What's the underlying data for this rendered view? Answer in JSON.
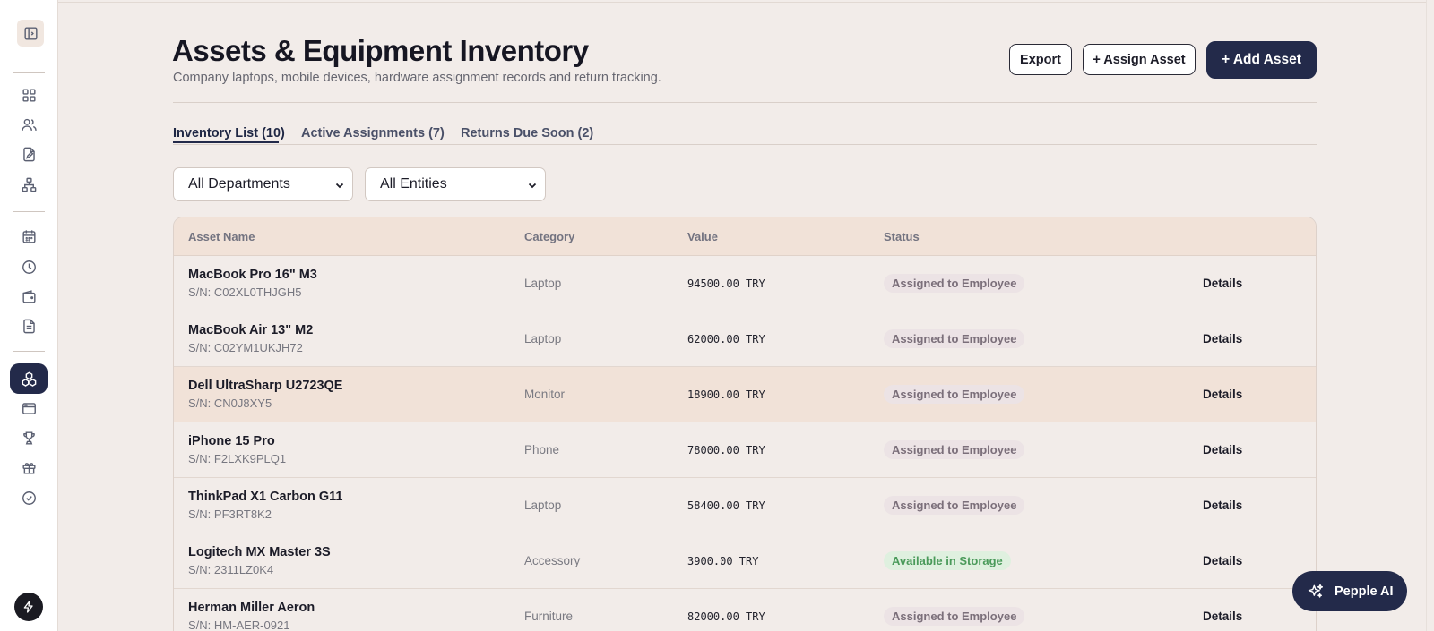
{
  "header": {
    "title": "Assets & Equipment Inventory",
    "subtitle": "Company laptops, mobile devices, hardware assignment records and return tracking.",
    "export_label": "Export",
    "assign_label": "+ Assign Asset",
    "add_label": "+ Add Asset"
  },
  "tabs": [
    {
      "label": "Inventory List (10)",
      "active": true
    },
    {
      "label": "Active Assignments (7)",
      "active": false
    },
    {
      "label": "Returns Due Soon (2)",
      "active": false
    }
  ],
  "filters": {
    "department": "All Departments",
    "entity": "All Entities"
  },
  "table": {
    "columns": [
      "Asset Name",
      "Category",
      "Value",
      "Status"
    ],
    "rows": [
      {
        "name": "MacBook Pro 16\" M3",
        "sn": "S/N: C02XL0THJGH5",
        "category": "Laptop",
        "value": "94500.00 TRY",
        "status": "Assigned to Employee",
        "status_type": "assigned",
        "action": "Details"
      },
      {
        "name": "MacBook Air 13\" M2",
        "sn": "S/N: C02YM1UKJH72",
        "category": "Laptop",
        "value": "62000.00 TRY",
        "status": "Assigned to Employee",
        "status_type": "assigned",
        "action": "Details"
      },
      {
        "name": "Dell UltraSharp U2723QE",
        "sn": "S/N: CN0J8XY5",
        "category": "Monitor",
        "value": "18900.00 TRY",
        "status": "Assigned to Employee",
        "status_type": "assigned",
        "action": "Details"
      },
      {
        "name": "iPhone 15 Pro",
        "sn": "S/N: F2LXK9PLQ1",
        "category": "Phone",
        "value": "78000.00 TRY",
        "status": "Assigned to Employee",
        "status_type": "assigned",
        "action": "Details"
      },
      {
        "name": "ThinkPad X1 Carbon G11",
        "sn": "S/N: PF3RT8K2",
        "category": "Laptop",
        "value": "58400.00 TRY",
        "status": "Assigned to Employee",
        "status_type": "assigned",
        "action": "Details"
      },
      {
        "name": "Logitech MX Master 3S",
        "sn": "S/N: 2311LZ0K4",
        "category": "Accessory",
        "value": "3900.00 TRY",
        "status": "Available in Storage",
        "status_type": "available",
        "action": "Details"
      },
      {
        "name": "Herman Miller Aeron",
        "sn": "S/N: HM-AER-0921",
        "category": "Furniture",
        "value": "82000.00 TRY",
        "status": "Assigned to Employee",
        "status_type": "assigned",
        "action": "Details"
      }
    ]
  },
  "ai_button": {
    "label": "Pepple AI",
    "icon": "sparkles-icon"
  },
  "sidebar": {
    "icons": [
      "panel-toggle-icon",
      "dashboard-grid-icon",
      "people-icon",
      "document-edit-icon",
      "org-chart-icon",
      "calendar-icon",
      "clock-icon",
      "wallet-icon",
      "file-text-icon",
      "assets-boxes-icon",
      "browser-window-icon",
      "trophy-icon",
      "gift-icon",
      "check-circle-icon",
      "bolt-icon"
    ]
  },
  "colors": {
    "accent": "#232a4a",
    "background": "#f2ece9",
    "header_row": "#f1e2d8",
    "assigned_badge": "#ece3e5",
    "available_badge": "#dff0df"
  }
}
